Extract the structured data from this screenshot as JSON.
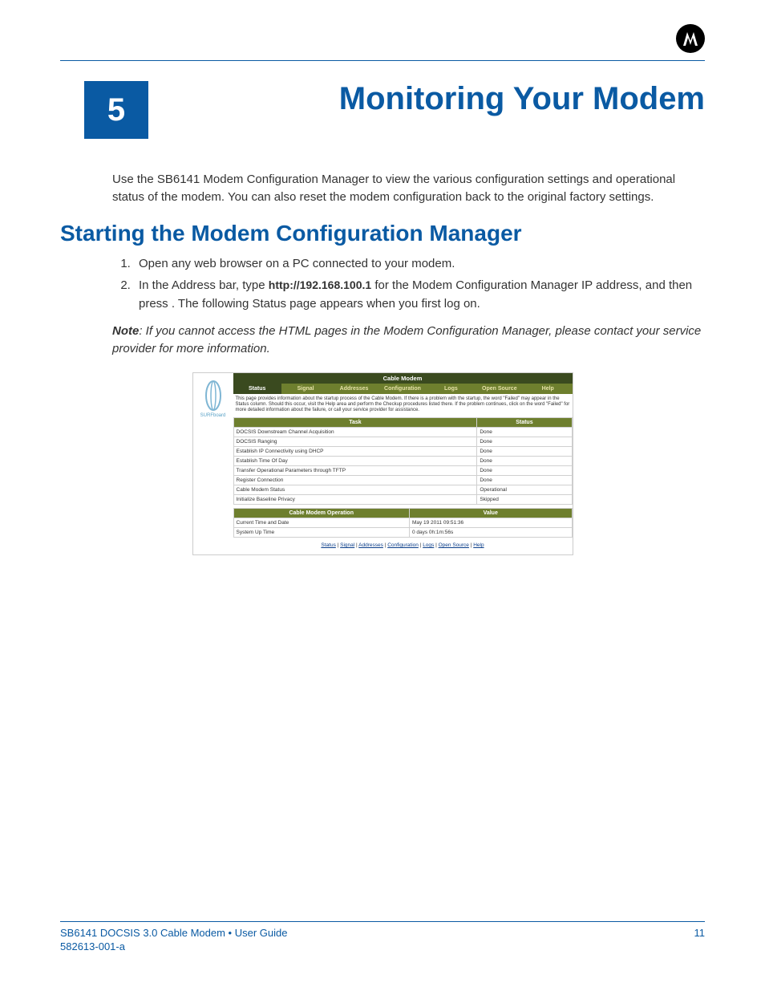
{
  "chapter": {
    "number": "5",
    "title": "Monitoring Your Modem"
  },
  "intro": "Use the SB6141 Modem Configuration Manager to view the various configuration settings and operational status of the modem. You can also reset the modem configuration back to the original factory settings.",
  "section": {
    "heading": "Starting the Modem Configuration Manager"
  },
  "steps": {
    "s1": "Open any web browser on a PC connected to your modem.",
    "s2a": "In the Address bar, type ",
    "s2url": "http://192.168.100.1",
    "s2b": " for the Modem Configuration Manager IP address, and then press ",
    "s2c": ". The following Status page appears when you first log on."
  },
  "note": {
    "label": "Note",
    "text": ": If you cannot access the HTML pages in the Modem Configuration Manager, please contact your service provider for more information."
  },
  "modem": {
    "brand": "SURFboard",
    "title": "Cable Modem",
    "tabs": [
      "Status",
      "Signal",
      "Addresses",
      "Configuration",
      "Logs",
      "Open Source",
      "Help"
    ],
    "description": "This page provides information about the startup process of the Cable Modem. If there is a problem with the startup, the word \"Failed\" may appear in the Status column. Should this occur, visit the Help area and perform the Checkup procedures listed there. If the problem continues, click on the word \"Failed\" for more detailed information about the failure, or call your service provider for assistance.",
    "task_header": {
      "task": "Task",
      "status": "Status"
    },
    "tasks": [
      {
        "task": "DOCSIS Downstream Channel Acquisition",
        "status": "Done"
      },
      {
        "task": "DOCSIS Ranging",
        "status": "Done"
      },
      {
        "task": "Establish IP Connectivity using DHCP",
        "status": "Done"
      },
      {
        "task": "Establish Time Of Day",
        "status": "Done"
      },
      {
        "task": "Transfer Operational Parameters through TFTP",
        "status": "Done"
      },
      {
        "task": "Register Connection",
        "status": "Done"
      },
      {
        "task": "Cable Modem Status",
        "status": "Operational"
      },
      {
        "task": "Initialize Baseline Privacy",
        "status": "Skipped"
      }
    ],
    "op_header": {
      "op": "Cable Modem Operation",
      "val": "Value"
    },
    "ops": [
      {
        "op": "Current Time and Date",
        "val": "May 19 2011 09:51:36"
      },
      {
        "op": "System Up Time",
        "val": "0 days 0h:1m:56s"
      }
    ],
    "footer_links": [
      "Status",
      "Signal",
      "Addresses",
      "Configuration",
      "Logs",
      "Open Source",
      "Help"
    ]
  },
  "footer": {
    "left": "SB6141 DOCSIS 3.0 Cable Modem • User Guide",
    "right": "11",
    "doc": "582613-001-a"
  }
}
